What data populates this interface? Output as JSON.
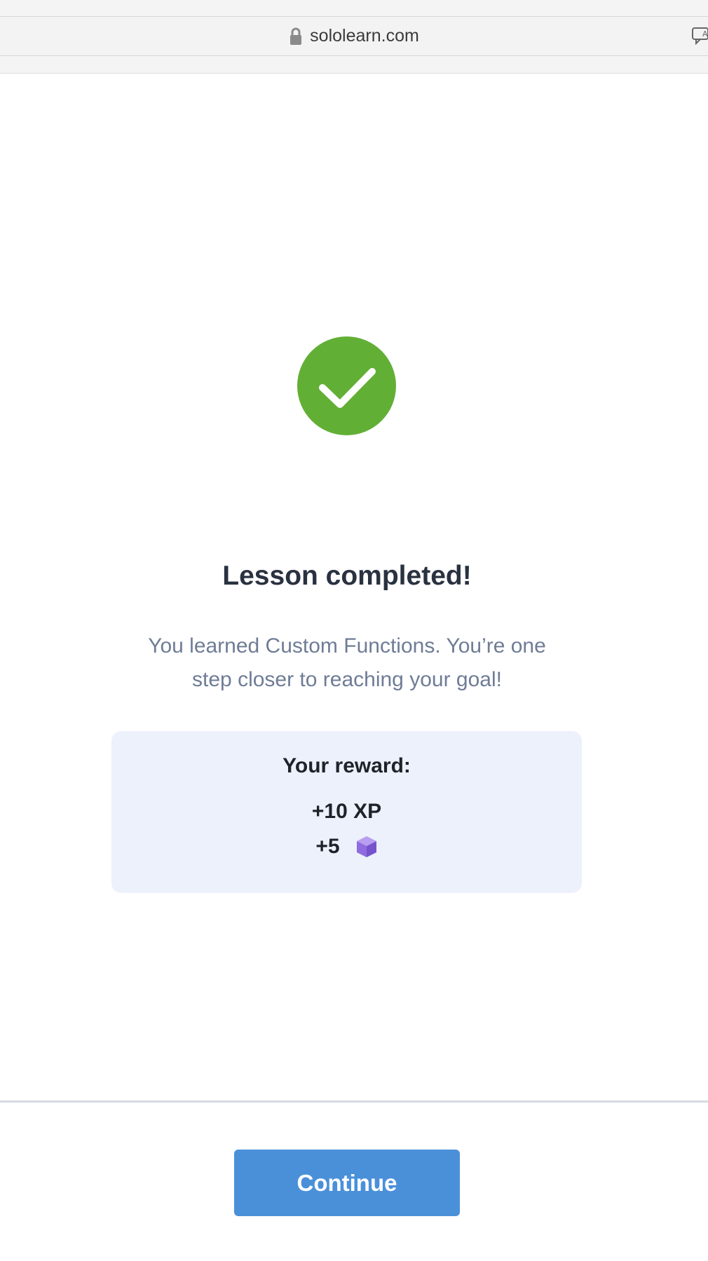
{
  "browser": {
    "url": "sololearn.com"
  },
  "lesson": {
    "title": "Lesson completed!",
    "message": "You learned Custom Functions. You’re one step closer to reaching your goal!"
  },
  "reward": {
    "title": "Your reward:",
    "xp": "+10 XP",
    "bits": "+5"
  },
  "actions": {
    "continue_label": "Continue"
  },
  "colors": {
    "success_green": "#62af35",
    "button_blue": "#4a90d9",
    "reward_bg": "#edf1fb",
    "bits_purple": "#8f6ae0"
  },
  "icons": [
    "lock-icon",
    "translate-icon",
    "checkmark-icon",
    "bits-cube-icon"
  ]
}
